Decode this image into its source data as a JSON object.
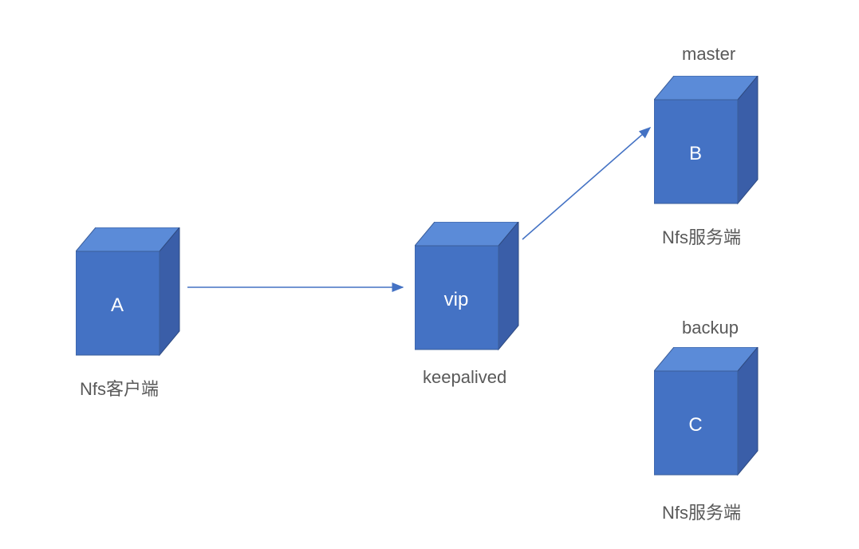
{
  "nodes": {
    "a": {
      "letter": "A",
      "labelBelow": "Nfs客户端"
    },
    "vip": {
      "letter": "vip",
      "labelBelow": "keepalived"
    },
    "b": {
      "letter": "B",
      "labelAbove": "master",
      "labelBelow": "Nfs服务端"
    },
    "c": {
      "letter": "C",
      "labelAbove": "backup",
      "labelBelow": "Nfs服务端"
    }
  }
}
